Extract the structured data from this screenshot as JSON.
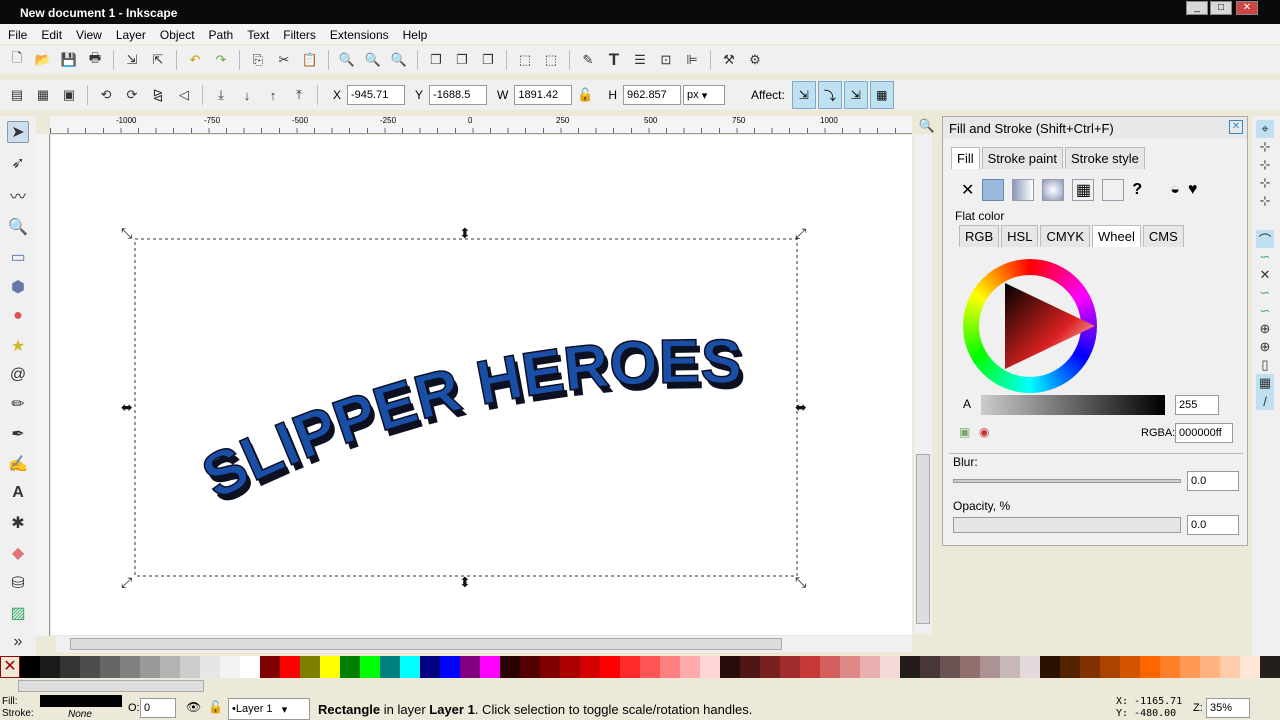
{
  "window": {
    "title": "New document 1 - Inkscape"
  },
  "menu": [
    "File",
    "Edit",
    "View",
    "Layer",
    "Object",
    "Path",
    "Text",
    "Filters",
    "Extensions",
    "Help"
  ],
  "toolcontrols": {
    "x_label": "X",
    "x": "-945.71",
    "y_label": "Y",
    "y": "-1688.5",
    "w_label": "W",
    "w": "1891.42",
    "h_label": "H",
    "h": "962.857",
    "unit": "px",
    "affect": "Affect:"
  },
  "ruler_ticks": [
    "-1000",
    "-750",
    "-500",
    "-250",
    "0",
    "250",
    "500",
    "750",
    "1000"
  ],
  "canvas": {
    "text": "SLIPPER HEROES",
    "text_color": "#1a4fa8"
  },
  "dialog": {
    "title": "Fill and Stroke (Shift+Ctrl+F)",
    "tabs": [
      "Fill",
      "Stroke paint",
      "Stroke style"
    ],
    "flat_color": "Flat color",
    "mode_tabs": [
      "RGB",
      "HSL",
      "CMYK",
      "Wheel",
      "CMS"
    ],
    "active_mode": "Wheel",
    "alpha_label": "A",
    "alpha": "255",
    "rgba_label": "RGBA:",
    "rgba": "000000ff",
    "blur_label": "Blur:",
    "blur": "0.0",
    "opacity_label": "Opacity, %",
    "opacity": "0.0",
    "unknown": "?"
  },
  "palette": [
    "#000000",
    "#1a1a1a",
    "#333333",
    "#4d4d4d",
    "#666666",
    "#808080",
    "#999999",
    "#b3b3b3",
    "#cccccc",
    "#e6e6e6",
    "#f2f2f2",
    "#ffffff",
    "#800000",
    "#ff0000",
    "#808000",
    "#ffff00",
    "#008000",
    "#00ff00",
    "#008080",
    "#00ffff",
    "#000080",
    "#0000ff",
    "#800080",
    "#ff00ff",
    "#2b0000",
    "#550000",
    "#800000",
    "#aa0000",
    "#d40000",
    "#ff0000",
    "#ff2a2a",
    "#ff5555",
    "#ff8080",
    "#ffaaaa",
    "#ffd5d5",
    "#280b0b",
    "#501616",
    "#782121",
    "#a02c2c",
    "#c83737",
    "#d35f5f",
    "#de8787",
    "#e9afaf",
    "#f4d7d7",
    "#241c1c",
    "#483737",
    "#6c5353",
    "#916f6f",
    "#ac9393",
    "#c8b7b7",
    "#e3dbdb",
    "#2b1100",
    "#552200",
    "#803300",
    "#aa4400",
    "#d45500",
    "#ff6600",
    "#ff7f2a",
    "#ff9955",
    "#ffb380",
    "#ffccaa",
    "#ffe6d5",
    "#241f1c"
  ],
  "status": {
    "fill_label": "Fill:",
    "stroke_label": "Stroke:",
    "stroke": "None",
    "opacity_label": "O:",
    "opacity": "0",
    "layer": "•Layer 1",
    "message_b1": "Rectangle",
    "message_1": " in layer ",
    "message_b2": "Layer 1",
    "message_2": ". Click selection to toggle scale/rotation handles.",
    "x": "X: -1165.71",
    "y": "Y:  -480.00",
    "zoom_label": "Z:",
    "zoom": "35%"
  }
}
